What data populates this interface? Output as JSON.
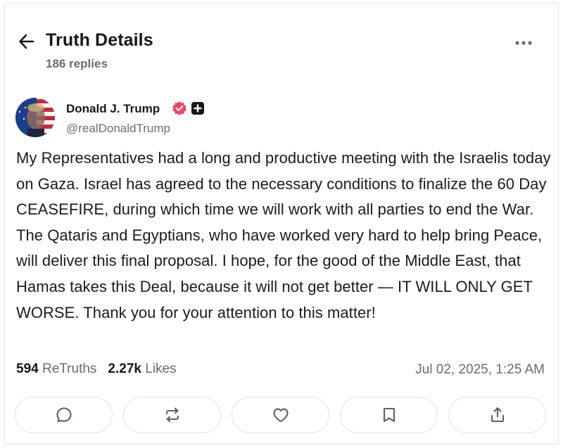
{
  "header": {
    "title": "Truth Details",
    "reply_count": "186 replies"
  },
  "author": {
    "display_name": "Donald J. Trump",
    "handle": "@realDonaldTrump"
  },
  "post": {
    "text": "My Representatives had a long and productive meeting with the Israelis today on Gaza. Israel has agreed to the necessary conditions to finalize the 60 Day CEASEFIRE, during which time we will work with all parties to end the War. The Qataris and Egyptians, who have worked very hard to help bring Peace, will deliver this final proposal. I hope, for the good of the Middle East, that Hamas takes this Deal, because it will not get better — IT WILL ONLY GET WORSE. Thank you for your attention to this matter!",
    "retruths_count": "594",
    "retruths_label": "ReTruths",
    "likes_count": "2.27k",
    "likes_label": "Likes",
    "timestamp": "Jul 02, 2025, 1:25 AM"
  },
  "actions": [
    "reply-icon",
    "retruth-icon",
    "like-icon",
    "bookmark-icon",
    "share-icon"
  ],
  "colors": {
    "verified_badge": "#f2455e",
    "text_primary": "#17161d",
    "text_secondary": "#6b6a78",
    "border": "#e2e1e8"
  }
}
